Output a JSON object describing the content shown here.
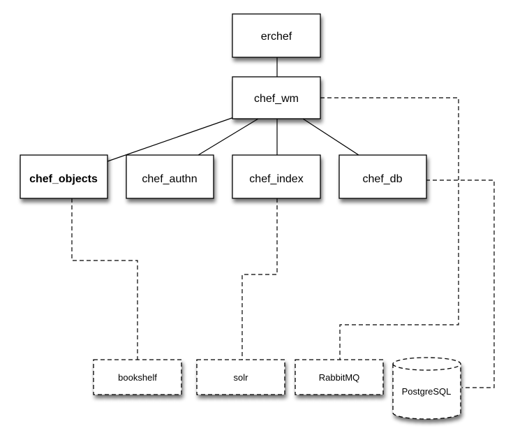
{
  "nodes": {
    "erchef": "erchef",
    "chef_wm": "chef_wm",
    "chef_objects": "chef_objects",
    "chef_authn": "chef_authn",
    "chef_index": "chef_index",
    "chef_db": "chef_db",
    "bookshelf": "bookshelf",
    "solr": "solr",
    "rabbitmq": "RabbitMQ",
    "postgresql": "PostgreSQL"
  },
  "edges": [
    {
      "from": "erchef",
      "to": "chef_wm",
      "style": "solid"
    },
    {
      "from": "chef_wm",
      "to": "chef_objects",
      "style": "solid"
    },
    {
      "from": "chef_wm",
      "to": "chef_authn",
      "style": "solid"
    },
    {
      "from": "chef_wm",
      "to": "chef_index",
      "style": "solid"
    },
    {
      "from": "chef_wm",
      "to": "chef_db",
      "style": "solid"
    },
    {
      "from": "chef_objects",
      "to": "bookshelf",
      "style": "dashed"
    },
    {
      "from": "chef_index",
      "to": "solr",
      "style": "dashed"
    },
    {
      "from": "chef_wm",
      "to": "rabbitmq",
      "style": "dashed"
    },
    {
      "from": "chef_db",
      "to": "postgresql",
      "style": "dashed"
    }
  ]
}
